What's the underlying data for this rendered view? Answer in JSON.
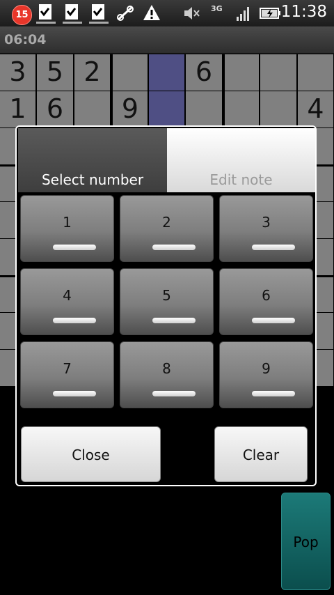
{
  "status_bar": {
    "notification_count": "15",
    "network": "3G",
    "time": "11:38",
    "icons": [
      "badge-icon",
      "download-icon",
      "download-icon",
      "download-icon",
      "sync-icon",
      "warning-icon",
      "mute-icon",
      "signal-icon",
      "battery-icon"
    ]
  },
  "timer": "06:04",
  "board": {
    "rows": [
      [
        "3",
        "5",
        "2",
        "",
        "",
        "6",
        "",
        "",
        ""
      ],
      [
        "1",
        "6",
        "",
        "9",
        "",
        "",
        "",
        "",
        "4"
      ]
    ],
    "highlight_col": 4
  },
  "dialog": {
    "tabs": [
      {
        "label": "Select number",
        "active": true
      },
      {
        "label": "Edit note",
        "active": false
      }
    ],
    "numbers": [
      "1",
      "2",
      "3",
      "4",
      "5",
      "6",
      "7",
      "8",
      "9"
    ],
    "close_label": "Close",
    "clear_label": "Clear"
  },
  "pop_label": "Pop",
  "colors": {
    "cell": "#808080",
    "highlight": "#4f4f84",
    "pop_button": "#0b4e4d"
  }
}
